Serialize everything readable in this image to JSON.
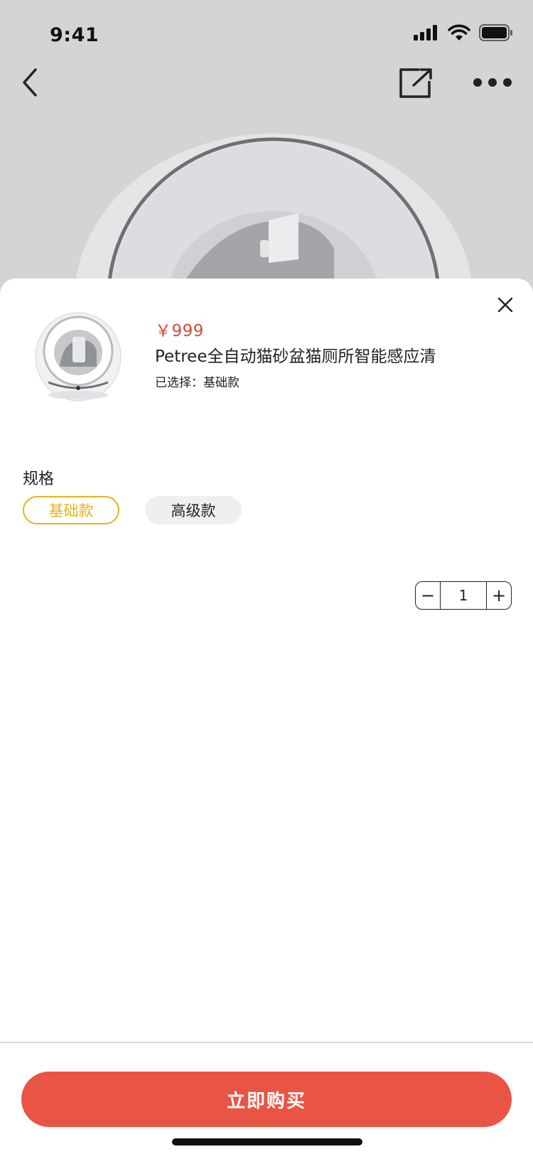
{
  "status_bar": {
    "time": "9:41",
    "icons": [
      "signal-icon",
      "wifi-icon",
      "battery-icon"
    ]
  },
  "top_nav": {
    "icons": [
      "back-chevron-icon",
      "share-icon",
      "more-dots-icon"
    ]
  },
  "product": {
    "price": "￥999",
    "title": "Petree全自动猫砂盆猫厕所智能感应清",
    "selected_prefix": "已选择：",
    "selected_value": "基础款"
  },
  "spec": {
    "label": "规格",
    "options": [
      {
        "label": "基础款",
        "selected": true
      },
      {
        "label": "高级款",
        "selected": false
      }
    ]
  },
  "quantity": {
    "minus": "−",
    "value": "1",
    "plus": "+"
  },
  "buy_button": {
    "label": "立即购买"
  },
  "colors": {
    "accent_selected": "#e8b21e",
    "price_red": "#d9483b",
    "buy_red": "#ea5444",
    "background_dim": "#d4d4d4"
  }
}
